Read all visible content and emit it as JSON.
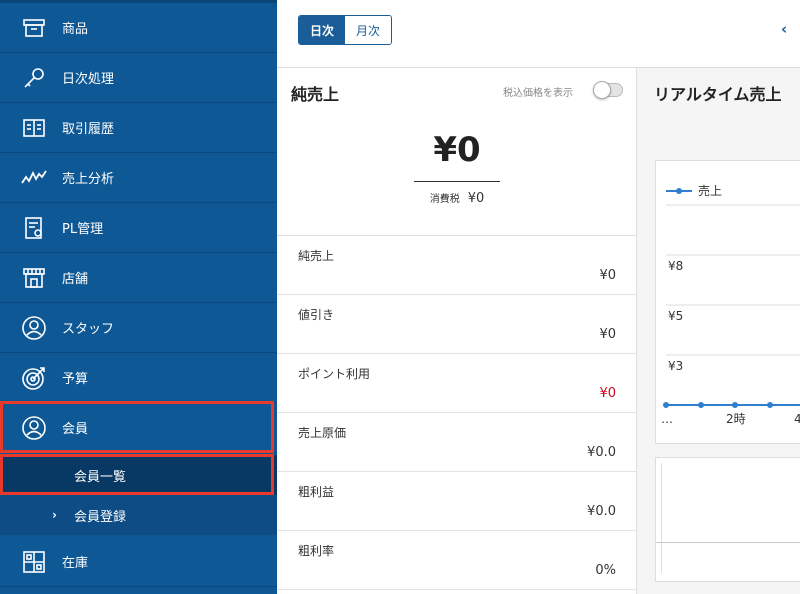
{
  "sidebar": {
    "items": [
      {
        "label": "商品",
        "icon": "box-icon"
      },
      {
        "label": "日次処理",
        "icon": "key-icon"
      },
      {
        "label": "取引履歴",
        "icon": "book-icon"
      },
      {
        "label": "売上分析",
        "icon": "trend-icon"
      },
      {
        "label": "PL管理",
        "icon": "report-icon"
      },
      {
        "label": "店舗",
        "icon": "store-icon"
      },
      {
        "label": "スタッフ",
        "icon": "staff-icon"
      },
      {
        "label": "予算",
        "icon": "target-icon"
      },
      {
        "label": "会員",
        "icon": "member-icon"
      },
      {
        "label": "在庫",
        "icon": "inventory-icon"
      }
    ],
    "sub_items": [
      {
        "label": "会員一覧"
      },
      {
        "label": "会員登録",
        "chevron": "›"
      }
    ]
  },
  "topbar": {
    "period_daily": "日次",
    "period_monthly": "月次",
    "back_chevron": "‹"
  },
  "sales": {
    "title": "純売上",
    "tax_toggle_label": "税込価格を表示",
    "total": "¥0",
    "tax_label": "消費税",
    "tax_value": "¥0",
    "rows": [
      {
        "label": "純売上",
        "value": "¥0"
      },
      {
        "label": "値引き",
        "value": "¥0"
      },
      {
        "label": "ポイント利用",
        "value": "¥0"
      },
      {
        "label": "売上原価",
        "value": "¥0.0"
      },
      {
        "label": "粗利益",
        "value": "¥0.0"
      },
      {
        "label": "粗利率",
        "value": "0%"
      }
    ]
  },
  "realtime": {
    "title": "リアルタイム売上",
    "legend": "売上",
    "y_ticks": [
      "¥8",
      "¥5",
      "¥3"
    ],
    "x_ticks": [
      "…",
      "2時",
      "4"
    ],
    "series_color": "#2f7fd1"
  },
  "colors": {
    "sidebar": "#0f5896",
    "accent": "#1a5d98",
    "highlight": "#e8392d",
    "negative": "#d0021b"
  }
}
